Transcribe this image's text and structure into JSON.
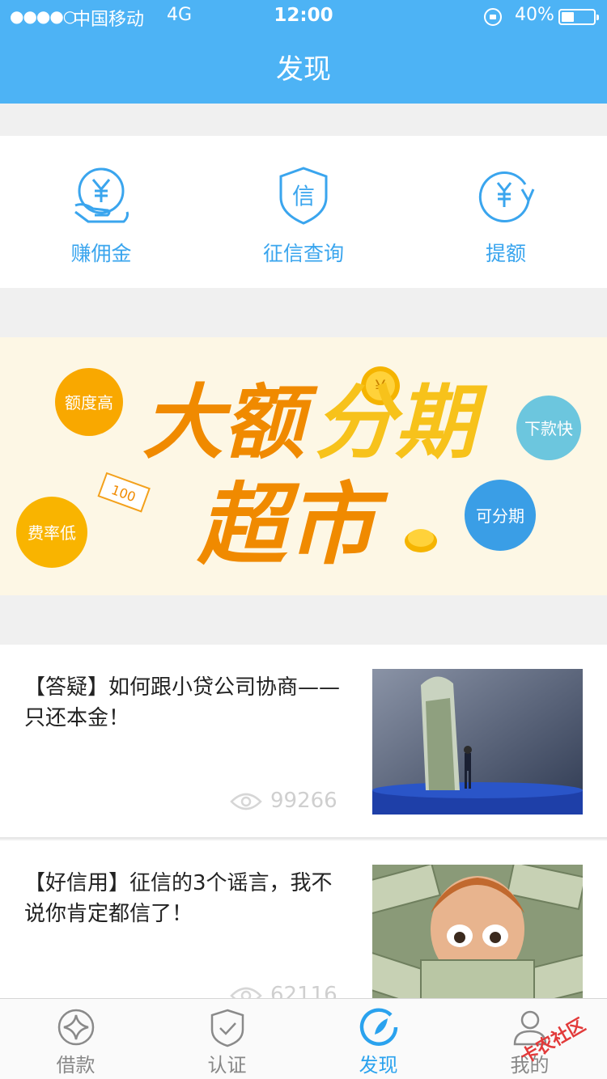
{
  "status_bar": {
    "signal": "●●●●○",
    "carrier": "中国移动",
    "network": "4G",
    "time": "12:00",
    "battery_text": "40%",
    "battery_level": 0.4
  },
  "nav": {
    "title": "发现"
  },
  "quick_actions": [
    {
      "label": "赚佣金",
      "icon": "yen-hand-icon"
    },
    {
      "label": "征信查询",
      "icon": "credit-shield-icon"
    },
    {
      "label": "提额",
      "icon": "yen-refresh-icon"
    }
  ],
  "banner": {
    "headline_1": "大额",
    "headline_2": "分期",
    "headline_3": "超市",
    "bubbles": [
      "额度高",
      "费率低",
      "下款快",
      "可分期"
    ],
    "note_value": "100",
    "coin_symbol": "¥"
  },
  "articles": [
    {
      "title": "【答疑】如何跟小贷公司协商——只还本金！",
      "views": "99266"
    },
    {
      "title": "【好信用】征信的3个谣言，我不说你肯定都信了！",
      "views": "62116"
    }
  ],
  "tabbar": {
    "tabs": [
      {
        "label": "借款",
        "icon": "loan-icon",
        "active": false
      },
      {
        "label": "认证",
        "icon": "verify-shield-icon",
        "active": false
      },
      {
        "label": "发现",
        "icon": "discover-icon",
        "active": true
      },
      {
        "label": "我的",
        "icon": "profile-icon",
        "active": false
      }
    ]
  },
  "watermark": {
    "text": "卡农社区"
  },
  "colors": {
    "brand_blue": "#4db3f5",
    "accent_blue": "#3aa5ee",
    "banner_orange": "#f08a00",
    "banner_yellow": "#f7c21b",
    "bubble_blue": "#3a9ee6",
    "bubble_teal": "#6cc6de"
  }
}
